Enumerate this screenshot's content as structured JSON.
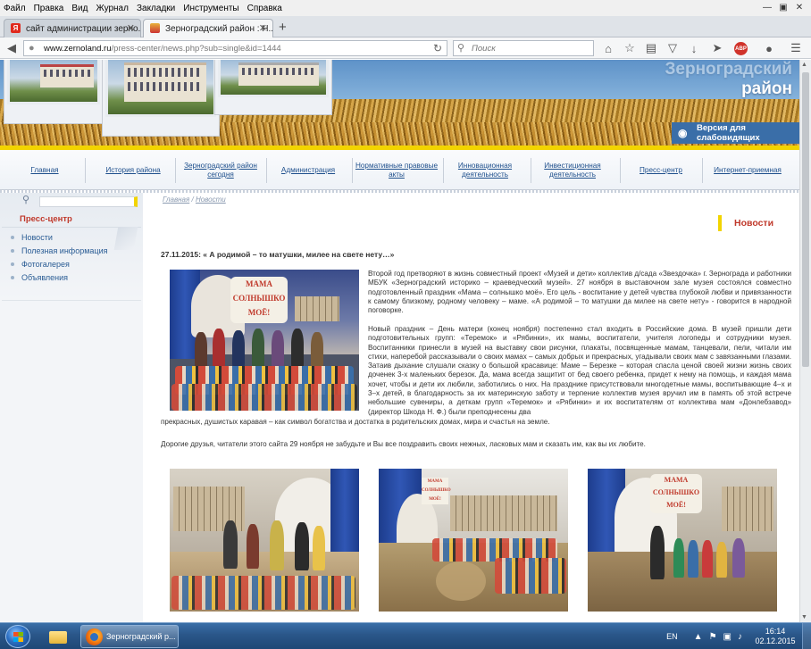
{
  "browser": {
    "menu": [
      "Файл",
      "Правка",
      "Вид",
      "Журнал",
      "Закладки",
      "Инструменты",
      "Справка"
    ],
    "tabs": [
      {
        "title": "сайт администрации зерно...",
        "favicon": "yandex-icon",
        "active": false
      },
      {
        "title": "Зерноградский район : Н...",
        "favicon": "site-icon",
        "active": true
      }
    ],
    "url_host": "www.zernoland.ru",
    "url_path": "/press-center/news.php?sub=single&id=1444",
    "search_placeholder": "Поиск",
    "abp_label": "ABP"
  },
  "site": {
    "district_title_line1": "Зерноградский",
    "district_title_line2": "район",
    "vision_button": "Версия для слабовидящих",
    "nav": [
      {
        "label": "Главная"
      },
      {
        "label": "История района"
      },
      {
        "label": "Зерноградский район сегодня"
      },
      {
        "label": "Администрация"
      },
      {
        "label": "Нормативные правовые акты"
      },
      {
        "label": "Инновационная деятельность"
      },
      {
        "label": "Инвестиционная деятельность"
      },
      {
        "label": "Пресс-центр"
      },
      {
        "label": "Интернет-приемная"
      }
    ],
    "sidebar": {
      "title": "Пресс-центр",
      "items": [
        "Новости",
        "Полезная информация",
        "Фотогалерея",
        "Объявления"
      ]
    },
    "breadcrumb": {
      "home": "Главная",
      "sep": " / ",
      "current": "Новости"
    },
    "section_title": "Новости",
    "article": {
      "date_title": "27.11.2015: « А родимой – то матушки, милее на свете нету…»",
      "photo_banner": "МАМА СОЛНЫШКО МОЁ!",
      "gallery_banner": "МАМА СОЛНЫШКО МОЁ!",
      "p1": "Второй год претворяют в жизнь совместный проект «Музей и дети» коллектив д/сада «Звездочка» г. Зернограда и работники МБУК «Зерноградский историко – краеведческий музей». 27 ноября в выставочном зале музея состоялся совместно подготовленный праздник «Мама – солнышко моё». Его цель - воспитание у детей чувства глубокой любви и привязанности к самому близкому, родному человеку – маме. «А родимой – то матушки да милее на свете нету» - говорится в народной поговорке.",
      "p2": "Новый праздник – День матери (конец ноября) постепенно стал входить в Российские дома. В музей пришли дети подготовительных групп: «Теремок» и «Рябинки», их мамы, воспитатели, учителя логопеды и сотрудники музея. Воспитанники принесли в музей на выставку свои рисунки, плакаты, посвященные мамам, танцевали, пели, читали им стихи, наперебой рассказывали о своих мамах – самых добрых и прекрасных, угадывали своих мам с завязанными глазами. Затаив дыхание слушали сказку о большой красавице: Маме – Березке – которая спасла ценой своей жизни жизнь своих доченек 3-х маленьких березок. Да, мама всегда защитит от бед своего ребенка, придет к нему на помощь, и каждая мама хочет, чтобы и дети их любили, заботились о них. На празднике присутствовали многодетные мамы, воспитывающие 4–х и 3–х детей, в благодарность за их материнскую заботу и терпение коллектив музея вручил им в память об этой встрече небольшие сувениры, а деткам групп «Теремок» и «Рябинки» и их воспитателям от коллектива мам «Донлебзавод» (директор Шкода Н. Ф.) были преподнесены два",
      "p2_tail": "прекрасных, душистых каравая – как символ богатства и достатка в родительских домах, мира и счастья на земле.",
      "p3": "Дорогие друзья, читатели этого сайта 29 ноября не забудьте и Вы все поздравить своих нежных, ласковых мам и сказать им, как вы их любите."
    }
  },
  "taskbar": {
    "window_title": "Зерноградский р...",
    "lang": "EN",
    "time": "16:14",
    "date": "02.12.2015"
  }
}
